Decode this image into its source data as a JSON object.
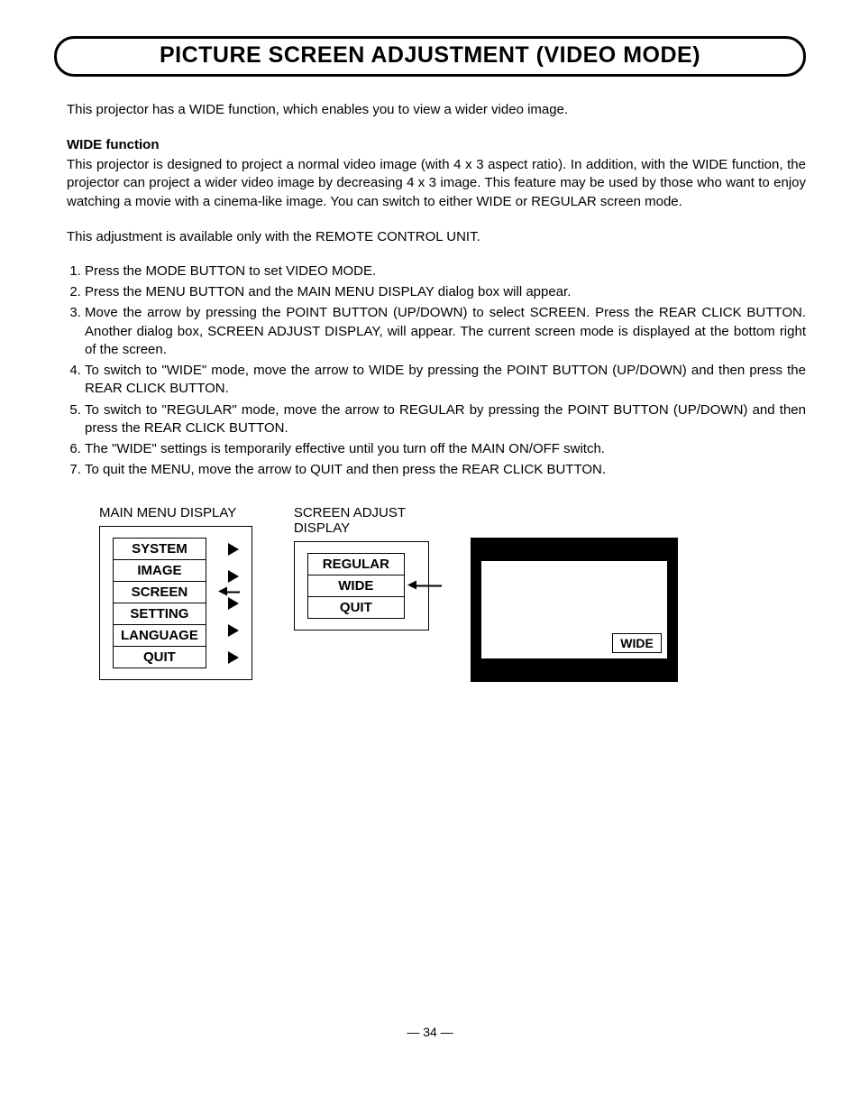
{
  "title": "PICTURE SCREEN ADJUSTMENT (VIDEO MODE)",
  "intro": "This projector has a WIDE function, which enables you to view a wider video image.",
  "wide_head": "WIDE function",
  "wide_body": "This projector is designed to project a normal video image (with 4 x 3 aspect ratio). In addition, with the WIDE function, the projector can project a wider video image by decreasing 4 x 3 image. This feature may be used by those who want to enjoy watching a movie with a cinema-like image. You can switch to either WIDE or REGULAR screen mode.",
  "note": "This adjustment is available only with the REMOTE CONTROL UNIT.",
  "steps": [
    "Press the MODE BUTTON to set VIDEO MODE.",
    "Press the MENU BUTTON and the MAIN MENU DISPLAY dialog box will appear.",
    "Move the arrow by pressing the POINT BUTTON (UP/DOWN) to select SCREEN. Press the REAR CLICK BUTTON. Another dialog box, SCREEN ADJUST DISPLAY, will appear. The current screen mode is displayed at the bottom right of the screen.",
    "To switch to \"WIDE\" mode, move the arrow to WIDE by pressing the POINT BUTTON (UP/DOWN) and then press the REAR CLICK BUTTON.",
    "To switch to \"REGULAR\" mode, move the arrow to REGULAR by pressing the POINT BUTTON (UP/DOWN) and then press the REAR CLICK BUTTON.",
    "The \"WIDE\" settings is temporarily effective until you turn off the MAIN ON/OFF switch.",
    "To quit the MENU, move the arrow to QUIT and then press the REAR CLICK BUTTON."
  ],
  "main_menu": {
    "title": "MAIN MENU DISPLAY",
    "items": [
      "SYSTEM",
      "IMAGE",
      "SCREEN",
      "SETTING",
      "LANGUAGE",
      "QUIT"
    ]
  },
  "screen_menu": {
    "title": "SCREEN ADJUST DISPLAY",
    "items": [
      "REGULAR",
      "WIDE",
      "QUIT"
    ]
  },
  "preview_label": "WIDE",
  "page": "— 34 —"
}
